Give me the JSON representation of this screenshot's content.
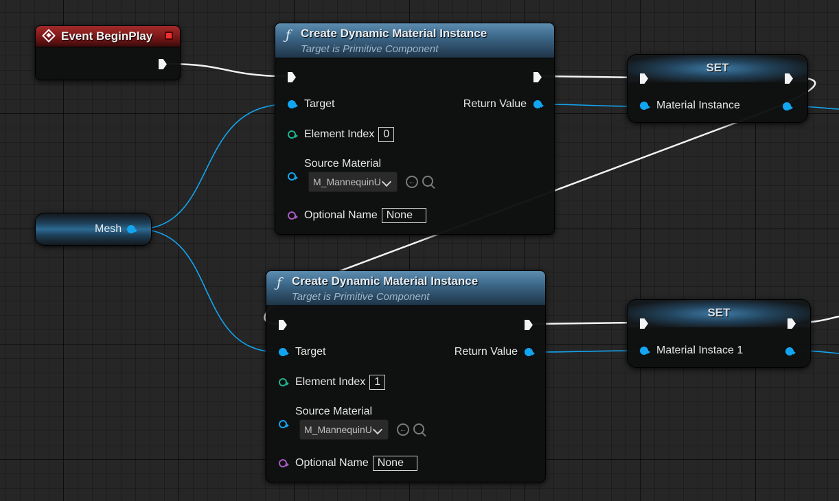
{
  "event_node": {
    "title": "Event BeginPlay"
  },
  "variable_node": {
    "label": "Mesh"
  },
  "function_nodes": [
    {
      "icon": "ƒ",
      "title": "Create Dynamic Material Instance",
      "subtitle": "Target is Primitive Component",
      "target_label": "Target",
      "return_label": "Return Value",
      "element_index_label": "Element Index",
      "element_index_value": "0",
      "source_material_label": "Source Material",
      "source_material_value": "M_MannequinUI",
      "optional_name_label": "Optional Name",
      "optional_name_value": "None"
    },
    {
      "icon": "ƒ",
      "title": "Create Dynamic Material Instance",
      "subtitle": "Target is Primitive Component",
      "target_label": "Target",
      "return_label": "Return Value",
      "element_index_label": "Element Index",
      "element_index_value": "1",
      "source_material_label": "Source Material",
      "source_material_value": "M_MannequinUI",
      "optional_name_label": "Optional Name",
      "optional_name_value": "None"
    }
  ],
  "set_nodes": [
    {
      "title": "SET",
      "variable_label": "Material Instance"
    },
    {
      "title": "SET",
      "variable_label": "Material Instace 1"
    }
  ],
  "colors": {
    "object_pin": "#12a6f2",
    "int_pin": "#1fb48e",
    "name_pin": "#a85ac4",
    "exec_wire": "#f4f4f4",
    "event_header": "#a22a2a",
    "function_header": "#3c6788"
  }
}
